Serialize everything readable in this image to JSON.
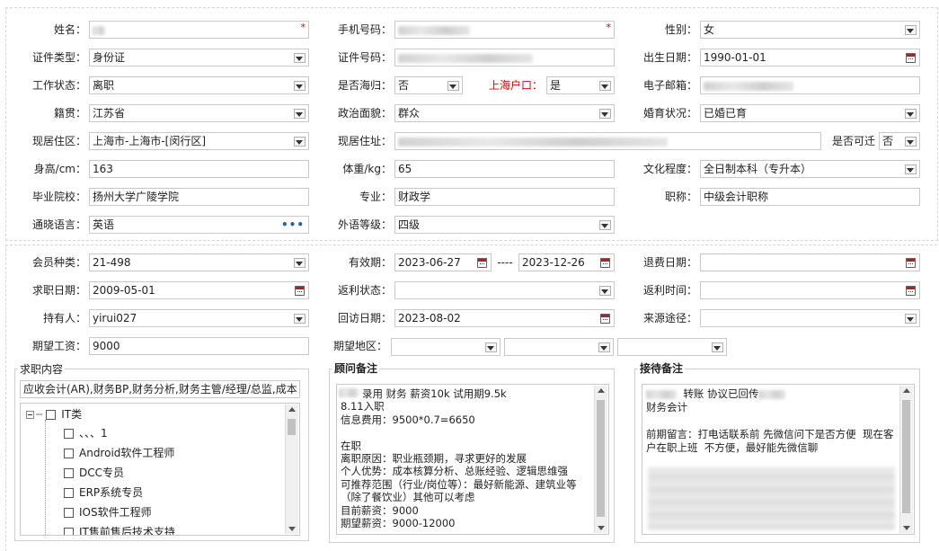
{
  "basic": {
    "name": {
      "label": "姓名：",
      "value": ""
    },
    "phone": {
      "label": "手机号码：",
      "value": ""
    },
    "gender": {
      "label": "性别：",
      "value": "女"
    },
    "id_type": {
      "label": "证件类型：",
      "value": "身份证"
    },
    "id_number": {
      "label": "证件号码：",
      "value": ""
    },
    "birth_date": {
      "label": "出生日期：",
      "value": "1990-01-01"
    },
    "work_status": {
      "label": "工作状态：",
      "value": "离职"
    },
    "returnee": {
      "label": "是否海归：",
      "value": "否"
    },
    "shanghai_hukou": {
      "label": "上海户口：",
      "value": "是"
    },
    "email": {
      "label": "电子邮箱：",
      "value": ""
    },
    "native_place": {
      "label": "籍贯：",
      "value": "江苏省"
    },
    "political_status": {
      "label": "政治面貌：",
      "value": "群众"
    },
    "marital_status": {
      "label": "婚育状况：",
      "value": "已婚已育"
    },
    "residence_area": {
      "label": "现居住区：",
      "value": "上海市-上海市-[闵行区]"
    },
    "residence_address": {
      "label": "现居住址：",
      "value": ""
    },
    "reachable": {
      "label": "是否可迁",
      "value": "否"
    },
    "height": {
      "label": "身高/cm：",
      "value": "163"
    },
    "weight": {
      "label": "体重/kg：",
      "value": "65"
    },
    "education": {
      "label": "文化程度：",
      "value": "全日制本科（专升本）"
    },
    "school": {
      "label": "毕业院校：",
      "value": "扬州大学广陵学院"
    },
    "major": {
      "label": "专业：",
      "value": "财政学"
    },
    "title": {
      "label": "职称：",
      "value": "中级会计职称"
    },
    "language": {
      "label": "通晓语言：",
      "value": "英语"
    },
    "foreign_level": {
      "label": "外语等级：",
      "value": "四级"
    }
  },
  "member": {
    "member_type": {
      "label": "会员种类：",
      "value": "21-498"
    },
    "validity": {
      "label": "有效期：",
      "start": "2023-06-27",
      "sep": "----",
      "end": "2023-12-26"
    },
    "refund_date": {
      "label": "退费日期：",
      "value": ""
    },
    "job_date": {
      "label": "求职日期：",
      "value": "2009-05-01"
    },
    "rebate_status": {
      "label": "返利状态：",
      "value": ""
    },
    "rebate_time": {
      "label": "返利时间：",
      "value": ""
    },
    "holder": {
      "label": "持有人：",
      "value": "yirui027"
    },
    "visit_date": {
      "label": "回访日期：",
      "value": "2023-08-02"
    },
    "source": {
      "label": "来源途径：",
      "value": ""
    },
    "expected_salary": {
      "label": "期望工资：",
      "value": "9000"
    },
    "expected_region": {
      "label": "期望地区：",
      "value": ""
    }
  },
  "job_content": {
    "title": "求职内容",
    "summary": "应收会计(AR),财务BP,财务分析,财务主管/经理/总监,成本",
    "tree_root": "IT类",
    "items": [
      "、、、1",
      "Android软件工程师",
      "DCC专员",
      "ERP系统专员",
      "IOS软件工程师",
      "IT售前售后技术支持"
    ]
  },
  "consultant_note": {
    "title": "顾问备注",
    "text": "录用 财务 薪资10k 试用期9.5k\n8.11入职\n信息费用：9500*0.7=6650\n\n在职\n离职原因：职业瓶颈期，寻求更好的发展\n个人优势：成本核算分析、总账经验、逻辑思维强\n可推荐范围（行业/岗位等）：最好新能源、建筑业等（除了餐饮业）其他可以考虑\n目前薪资：9000\n期望薪资：9000-12000"
  },
  "reception_note": {
    "title": "接待备注",
    "line1": "转账 协议已回传",
    "line2": "财务会计",
    "line3": "前期留言：打电话联系前 先微信问下是否方便  现在客户在职上班  不方便，最好能先微信聊"
  },
  "icons": {
    "select": "chevron-down-icon",
    "calendar": "calendar-icon",
    "more": "ellipsis-icon",
    "required": "required-asterisk-icon"
  },
  "colors": {
    "required": "#e00000",
    "border": "#c8c8c8",
    "link": "#2b5ea8"
  }
}
